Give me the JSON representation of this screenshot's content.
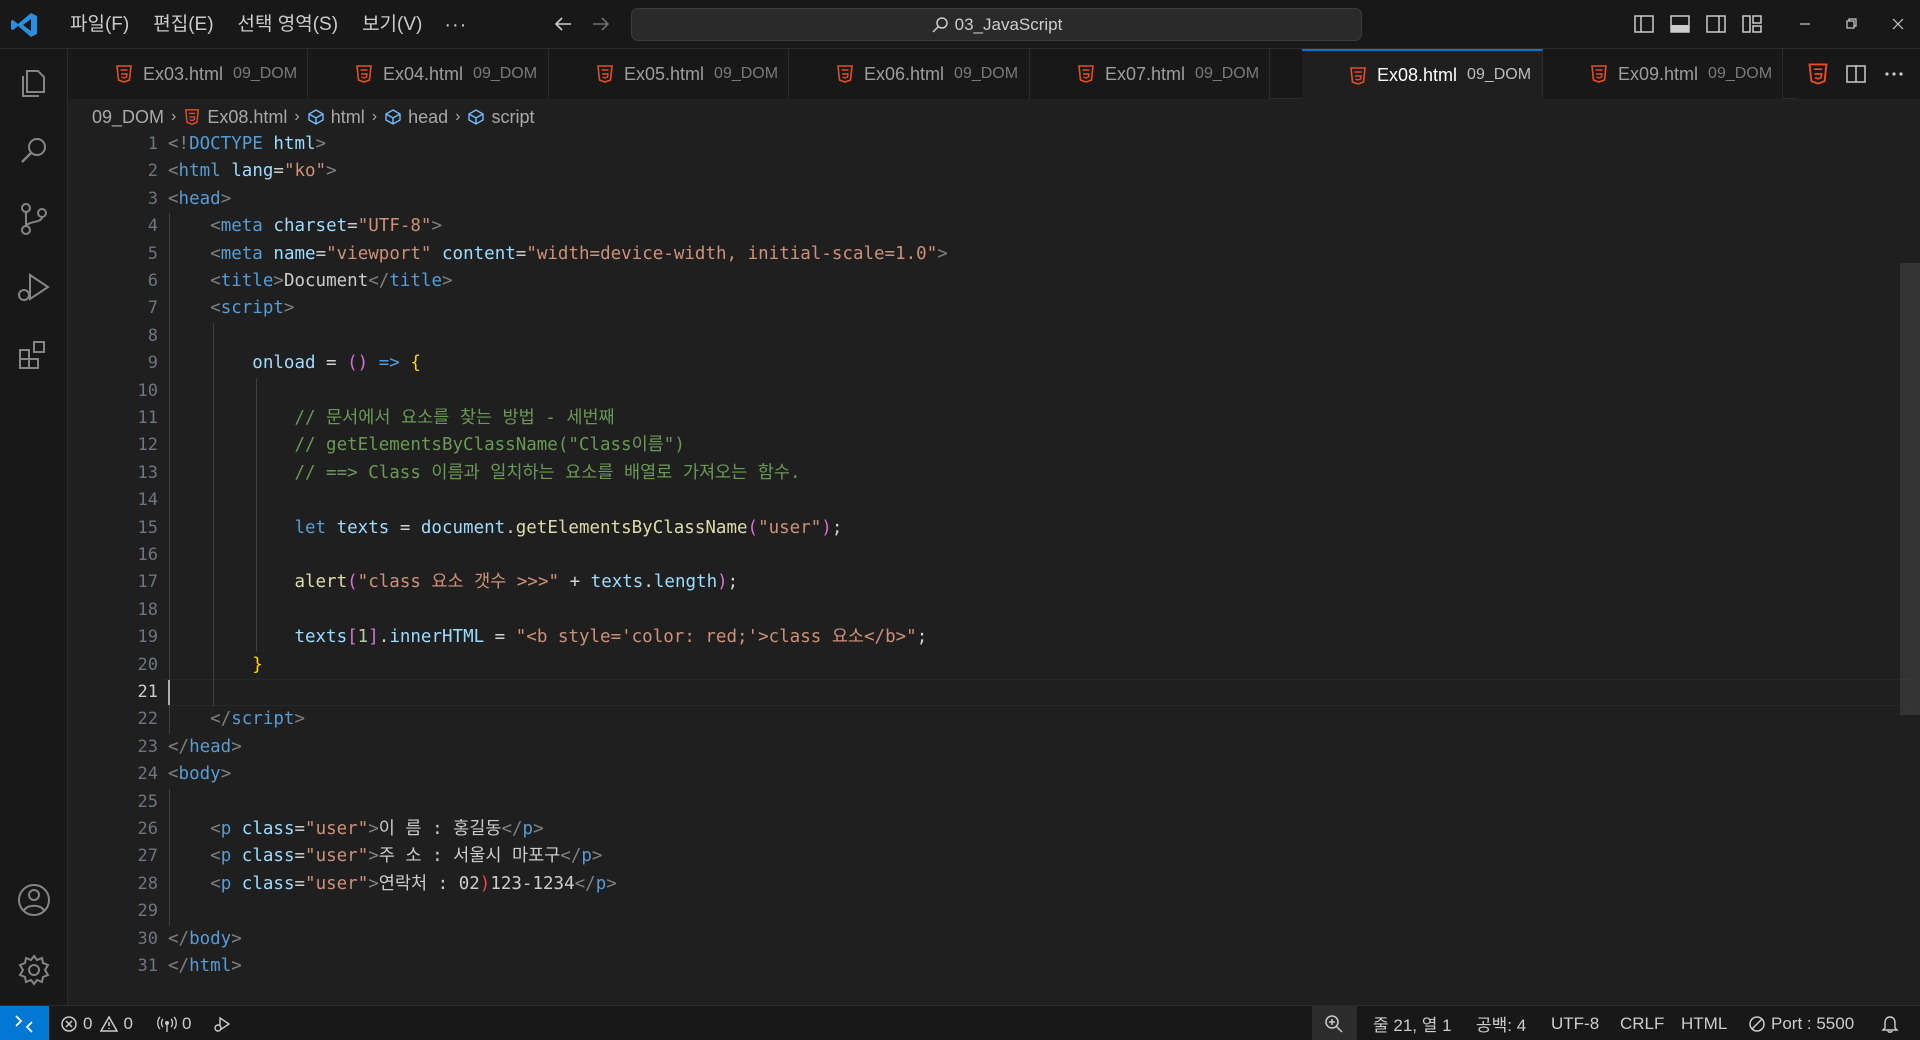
{
  "menu": [
    "파일(F)",
    "편집(E)",
    "선택 영역(S)",
    "보기(V)",
    "···"
  ],
  "search": {
    "text": "03_JavaScript"
  },
  "tabs": [
    {
      "name": "Ex03.html",
      "dir": "09_DOM",
      "active": false
    },
    {
      "name": "Ex04.html",
      "dir": "09_DOM",
      "active": false
    },
    {
      "name": "Ex05.html",
      "dir": "09_DOM",
      "active": false
    },
    {
      "name": "Ex06.html",
      "dir": "09_DOM",
      "active": false
    },
    {
      "name": "Ex07.html",
      "dir": "09_DOM",
      "active": false
    },
    {
      "name": "Ex08.html",
      "dir": "09_DOM",
      "active": true
    },
    {
      "name": "Ex09.html",
      "dir": "09_DOM",
      "active": false
    }
  ],
  "breadcrumb": [
    "09_DOM",
    "Ex08.html",
    "html",
    "head",
    "script"
  ],
  "editor": {
    "current_line": 21,
    "lines": [
      [
        [
          "t-br",
          "<!"
        ],
        [
          "t-tag",
          "DOCTYPE"
        ],
        [
          "t-txt",
          " "
        ],
        [
          "t-attr",
          "html"
        ],
        [
          "t-br",
          ">"
        ]
      ],
      [
        [
          "t-br",
          "<"
        ],
        [
          "t-tag",
          "html"
        ],
        [
          "t-txt",
          " "
        ],
        [
          "t-attr",
          "lang"
        ],
        [
          "t-txt",
          "="
        ],
        [
          "t-str",
          "\"ko\""
        ],
        [
          "t-br",
          ">"
        ]
      ],
      [
        [
          "t-br",
          "<"
        ],
        [
          "t-tag",
          "head"
        ],
        [
          "t-br",
          ">"
        ]
      ],
      [
        [
          "t-txt",
          "    "
        ],
        [
          "t-br",
          "<"
        ],
        [
          "t-tag",
          "meta"
        ],
        [
          "t-txt",
          " "
        ],
        [
          "t-attr",
          "charset"
        ],
        [
          "t-txt",
          "="
        ],
        [
          "t-str",
          "\"UTF-8\""
        ],
        [
          "t-br",
          ">"
        ]
      ],
      [
        [
          "t-txt",
          "    "
        ],
        [
          "t-br",
          "<"
        ],
        [
          "t-tag",
          "meta"
        ],
        [
          "t-txt",
          " "
        ],
        [
          "t-attr",
          "name"
        ],
        [
          "t-txt",
          "="
        ],
        [
          "t-str",
          "\"viewport\""
        ],
        [
          "t-txt",
          " "
        ],
        [
          "t-attr",
          "content"
        ],
        [
          "t-txt",
          "="
        ],
        [
          "t-str",
          "\"width=device-width, initial-scale=1.0\""
        ],
        [
          "t-br",
          ">"
        ]
      ],
      [
        [
          "t-txt",
          "    "
        ],
        [
          "t-br",
          "<"
        ],
        [
          "t-tag",
          "title"
        ],
        [
          "t-br",
          ">"
        ],
        [
          "t-txt",
          "Document"
        ],
        [
          "t-br",
          "</"
        ],
        [
          "t-tag",
          "title"
        ],
        [
          "t-br",
          ">"
        ]
      ],
      [
        [
          "t-txt",
          "    "
        ],
        [
          "t-br",
          "<"
        ],
        [
          "t-tag",
          "script"
        ],
        [
          "t-br",
          ">"
        ]
      ],
      [],
      [
        [
          "t-txt",
          "        "
        ],
        [
          "t-var",
          "onload"
        ],
        [
          "t-op",
          " = "
        ],
        [
          "t-p2",
          "("
        ],
        [
          "t-p2",
          ")"
        ],
        [
          "t-op",
          " "
        ],
        [
          "t-kw",
          "=>"
        ],
        [
          "t-op",
          " "
        ],
        [
          "t-p1",
          "{"
        ]
      ],
      [],
      [
        [
          "t-txt",
          "            "
        ],
        [
          "t-cmt",
          "// 문서에서 요소를 찾는 방법 - 세번째"
        ]
      ],
      [
        [
          "t-txt",
          "            "
        ],
        [
          "t-cmt",
          "// getElementsByClassName(\"Class이름\")"
        ]
      ],
      [
        [
          "t-txt",
          "            "
        ],
        [
          "t-cmt",
          "// ==> Class 이름과 일치하는 요소를 배열로 가져오는 함수."
        ]
      ],
      [],
      [
        [
          "t-txt",
          "            "
        ],
        [
          "t-kw",
          "let"
        ],
        [
          "t-txt",
          " "
        ],
        [
          "t-var",
          "texts"
        ],
        [
          "t-op",
          " = "
        ],
        [
          "t-var",
          "document"
        ],
        [
          "t-op",
          "."
        ],
        [
          "t-fn",
          "getElementsByClassName"
        ],
        [
          "t-p2",
          "("
        ],
        [
          "t-str",
          "\"user\""
        ],
        [
          "t-p2",
          ")"
        ],
        [
          "t-op",
          ";"
        ]
      ],
      [],
      [
        [
          "t-txt",
          "            "
        ],
        [
          "t-fn",
          "alert"
        ],
        [
          "t-p2",
          "("
        ],
        [
          "t-str",
          "\"class 요소 갯수 >>>\""
        ],
        [
          "t-op",
          " + "
        ],
        [
          "t-var",
          "texts"
        ],
        [
          "t-op",
          "."
        ],
        [
          "t-var",
          "length"
        ],
        [
          "t-p2",
          ")"
        ],
        [
          "t-op",
          ";"
        ]
      ],
      [],
      [
        [
          "t-txt",
          "            "
        ],
        [
          "t-var",
          "texts"
        ],
        [
          "t-p2",
          "["
        ],
        [
          "t-num",
          "1"
        ],
        [
          "t-p2",
          "]"
        ],
        [
          "t-op",
          "."
        ],
        [
          "t-var",
          "innerHTML"
        ],
        [
          "t-op",
          " = "
        ],
        [
          "t-str",
          "\"<b style='color: red;'>class 요소</b>\""
        ],
        [
          "t-op",
          ";"
        ]
      ],
      [
        [
          "t-txt",
          "        "
        ],
        [
          "t-p1",
          "}"
        ]
      ],
      [],
      [
        [
          "t-txt",
          "    "
        ],
        [
          "t-br",
          "</"
        ],
        [
          "t-tag",
          "script"
        ],
        [
          "t-br",
          ">"
        ]
      ],
      [
        [
          "t-br",
          "</"
        ],
        [
          "t-tag",
          "head"
        ],
        [
          "t-br",
          ">"
        ]
      ],
      [
        [
          "t-br",
          "<"
        ],
        [
          "t-tag",
          "body"
        ],
        [
          "t-br",
          ">"
        ]
      ],
      [],
      [
        [
          "t-txt",
          "    "
        ],
        [
          "t-br",
          "<"
        ],
        [
          "t-tag",
          "p"
        ],
        [
          "t-txt",
          " "
        ],
        [
          "t-attr",
          "class"
        ],
        [
          "t-txt",
          "="
        ],
        [
          "t-str",
          "\"user\""
        ],
        [
          "t-br",
          ">"
        ],
        [
          "t-txt",
          "이 름 : 홍길동"
        ],
        [
          "t-br",
          "</"
        ],
        [
          "t-tag",
          "p"
        ],
        [
          "t-br",
          ">"
        ]
      ],
      [
        [
          "t-txt",
          "    "
        ],
        [
          "t-br",
          "<"
        ],
        [
          "t-tag",
          "p"
        ],
        [
          "t-txt",
          " "
        ],
        [
          "t-attr",
          "class"
        ],
        [
          "t-txt",
          "="
        ],
        [
          "t-str",
          "\"user\""
        ],
        [
          "t-br",
          ">"
        ],
        [
          "t-txt",
          "주 소 : 서울시 마포구"
        ],
        [
          "t-br",
          "</"
        ],
        [
          "t-tag",
          "p"
        ],
        [
          "t-br",
          ">"
        ]
      ],
      [
        [
          "t-txt",
          "    "
        ],
        [
          "t-br",
          "<"
        ],
        [
          "t-tag",
          "p"
        ],
        [
          "t-txt",
          " "
        ],
        [
          "t-attr",
          "class"
        ],
        [
          "t-txt",
          "="
        ],
        [
          "t-str",
          "\"user\""
        ],
        [
          "t-br",
          ">"
        ],
        [
          "t-txt",
          "연락처 : 02"
        ],
        [
          "t-err",
          ")"
        ],
        [
          "t-txt",
          "123-1234"
        ],
        [
          "t-br",
          "</"
        ],
        [
          "t-tag",
          "p"
        ],
        [
          "t-br",
          ">"
        ]
      ],
      [],
      [
        [
          "t-br",
          "</"
        ],
        [
          "t-tag",
          "body"
        ],
        [
          "t-br",
          ">"
        ]
      ],
      [
        [
          "t-br",
          "</"
        ],
        [
          "t-tag",
          "html"
        ],
        [
          "t-br",
          ">"
        ]
      ]
    ]
  },
  "status": {
    "errors": "0",
    "warnings": "0",
    "ports": "0",
    "position": "줄 21, 열 1",
    "spaces": "공백: 4",
    "encoding": "UTF-8",
    "eol": "CRLF",
    "language": "HTML",
    "live_server": "Port : 5500"
  },
  "colors": {
    "accent": "#0078d4",
    "html_icon": "#e44d26"
  }
}
